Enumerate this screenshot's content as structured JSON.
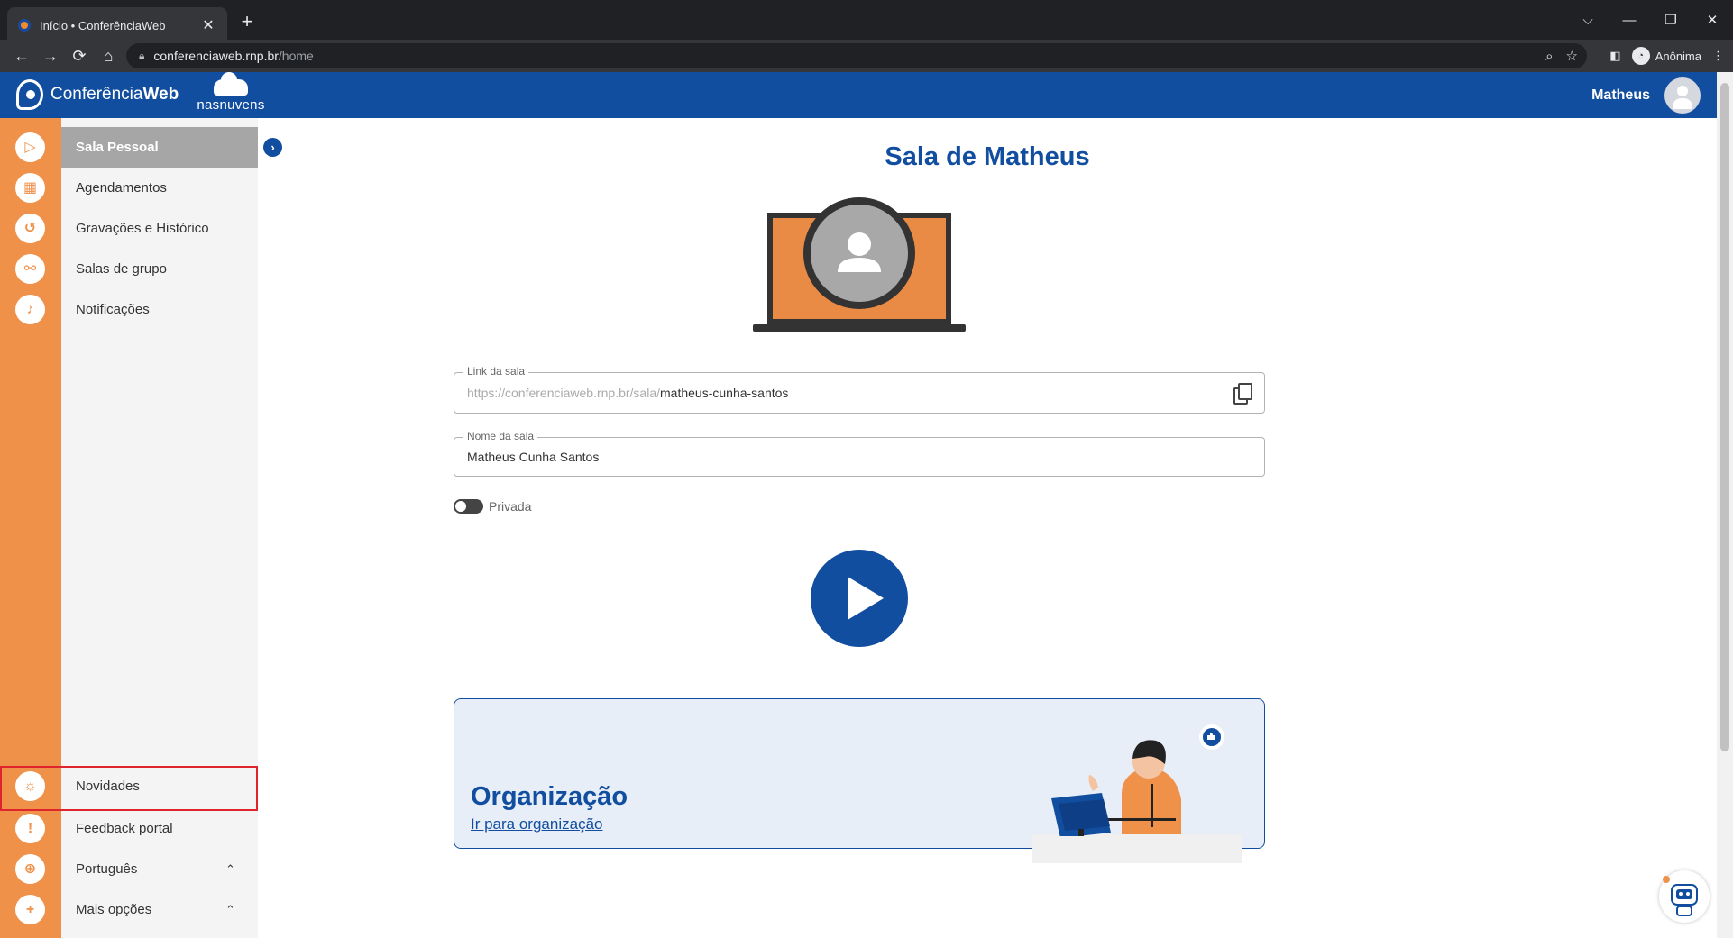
{
  "browser": {
    "tab_title": "Início • ConferênciaWeb",
    "tab_close": "✕",
    "new_tab": "+",
    "url_host": "conferenciaweb.rnp.br",
    "url_path": "/home",
    "incognito_label": "Anônima",
    "window_controls": {
      "tabs_menu": "⌵",
      "minimize": "—",
      "restore": "❐",
      "close": "✕"
    },
    "nav": {
      "back": "←",
      "forward": "→",
      "reload": "⟳",
      "home": "⌂"
    }
  },
  "header": {
    "brand_prefix": "Conferência",
    "brand_suffix": "Web",
    "partner": "nasnuvens",
    "user_name": "Matheus"
  },
  "sidebar": {
    "top_items": [
      {
        "label": "Sala Pessoal",
        "icon": "play-icon",
        "glyph": "▷"
      },
      {
        "label": "Agendamentos",
        "icon": "calendar-icon",
        "glyph": "▦"
      },
      {
        "label": "Gravações e Histórico",
        "icon": "history-icon",
        "glyph": "↺"
      },
      {
        "label": "Salas de grupo",
        "icon": "group-rooms-icon",
        "glyph": "⚯"
      },
      {
        "label": "Notificações",
        "icon": "bell-icon",
        "glyph": "♪"
      }
    ],
    "bottom_items": [
      {
        "label": "Novidades",
        "icon": "lightbulb-icon",
        "glyph": "☼"
      },
      {
        "label": "Feedback portal",
        "icon": "feedback-icon",
        "glyph": "!"
      },
      {
        "label": "Português",
        "icon": "globe-icon",
        "glyph": "⊕",
        "chevron": "⌃"
      },
      {
        "label": "Mais opções",
        "icon": "plus-icon",
        "glyph": "+",
        "chevron": "⌃"
      }
    ],
    "collapse_glyph": "›"
  },
  "main": {
    "title": "Sala de Matheus",
    "room_link": {
      "label": "Link da sala",
      "prefix": "https://conferenciaweb.rnp.br/sala/",
      "slug": "matheus-cunha-santos"
    },
    "room_name": {
      "label": "Nome da sala",
      "value": "Matheus Cunha Santos"
    },
    "private_label": "Privada",
    "organization": {
      "title": "Organização",
      "link": "Ir para organização"
    }
  },
  "colors": {
    "brand_blue": "#124ea0",
    "sidebar_orange": "#f0914a",
    "active_gray": "#a6a6a6",
    "highlight_red": "#e0242d"
  }
}
